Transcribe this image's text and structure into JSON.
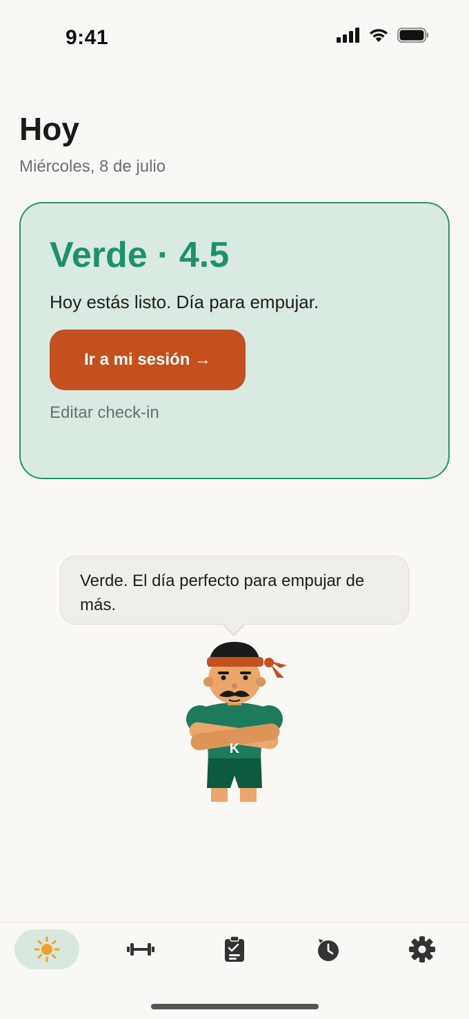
{
  "status_bar": {
    "time": "9:41"
  },
  "header": {
    "title": "Hoy",
    "date": "Miércoles, 8 de julio"
  },
  "status_card": {
    "heading": "Verde · 4.5",
    "message": "Hoy estás listo. Día para empujar.",
    "primary_button": "Ir a mi sesión →",
    "edit_link": "Editar check-in",
    "accent_color": "#1d9168",
    "button_color": "#c4501f"
  },
  "mascot": {
    "speech": "Verde. El día perfecto para empujar de más.",
    "shirt_letter": "K"
  },
  "tab_bar": {
    "tabs": [
      {
        "icon": "sun-icon",
        "active": true
      },
      {
        "icon": "dumbbell-icon",
        "active": false
      },
      {
        "icon": "clipboard-check-icon",
        "active": false
      },
      {
        "icon": "history-clock-icon",
        "active": false
      },
      {
        "icon": "gear-icon",
        "active": false
      }
    ]
  }
}
